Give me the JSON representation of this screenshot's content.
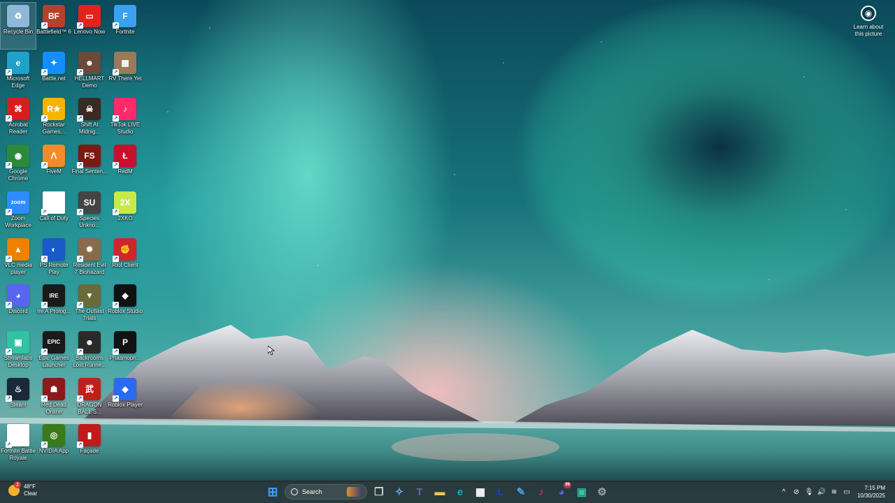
{
  "desktop": {
    "icons": [
      {
        "label": "Recycle Bin",
        "glyph": "♻",
        "color": "#8fb7d8",
        "shortcut": false
      },
      {
        "label": "Battlefield™ 6",
        "glyph": "BF",
        "color": "#b5412a",
        "shortcut": true
      },
      {
        "label": "Lenovo Now",
        "glyph": "▭",
        "color": "#e2231a",
        "shortcut": true
      },
      {
        "label": "Fortnite",
        "glyph": "F",
        "color": "#3aa0f0",
        "shortcut": true
      },
      {
        "label": "Microsoft Edge",
        "glyph": "e",
        "color": "#1fa2c9",
        "shortcut": true
      },
      {
        "label": "Battle.net",
        "glyph": "✦",
        "color": "#148eff",
        "shortcut": true
      },
      {
        "label": "HELLMART Demo",
        "glyph": "☻",
        "color": "#6b4a3a",
        "shortcut": true
      },
      {
        "label": "RV There Yet",
        "glyph": "▦",
        "color": "#9a7a5a",
        "shortcut": true
      },
      {
        "label": "Acrobat Reader",
        "glyph": "⌘",
        "color": "#d4201c",
        "shortcut": true
      },
      {
        "label": "Rockstar Games...",
        "glyph": "R★",
        "color": "#f5b400",
        "shortcut": true
      },
      {
        "label": "Shift At Midnig...",
        "glyph": "☠",
        "color": "#3a2a22",
        "shortcut": true
      },
      {
        "label": "TikTok LIVE Studio",
        "glyph": "♪",
        "color": "#ff2a6a",
        "shortcut": true
      },
      {
        "label": "Google Chrome",
        "glyph": "◉",
        "color": "#2a8a3a",
        "shortcut": true
      },
      {
        "label": "FiveM",
        "glyph": "ᐱ",
        "color": "#f38b29",
        "shortcut": true
      },
      {
        "label": "Final Senten...",
        "glyph": "FS",
        "color": "#7a1a12",
        "shortcut": true
      },
      {
        "label": "RedM",
        "glyph": "Ł",
        "color": "#c8102e",
        "shortcut": true
      },
      {
        "label": "Zoom Workplace",
        "glyph": "zoom",
        "color": "#2d8cff",
        "shortcut": true
      },
      {
        "label": "Call of Duty",
        "glyph": "",
        "color": "#ffffff",
        "shortcut": true
      },
      {
        "label": "Species Unkno...",
        "glyph": "SU",
        "color": "#444444",
        "shortcut": true
      },
      {
        "label": "2XKO",
        "glyph": "2X",
        "color": "#c9e84a",
        "shortcut": true
      },
      {
        "label": "VLC media player",
        "glyph": "▲",
        "color": "#f08000",
        "shortcut": true
      },
      {
        "label": "PS Remote Play",
        "glyph": "◐",
        "color": "#1a5ac8",
        "shortcut": true
      },
      {
        "label": "Resident Evil 7 Biohazard",
        "glyph": "✹",
        "color": "#8a6a48",
        "shortcut": true
      },
      {
        "label": "Riot Client",
        "glyph": "✊",
        "color": "#d0252a",
        "shortcut": true
      },
      {
        "label": "Discord",
        "glyph": "◕",
        "color": "#5865f2",
        "shortcut": true
      },
      {
        "label": "Ire A Prolog...",
        "glyph": "IRE",
        "color": "#1a1a1a",
        "shortcut": true
      },
      {
        "label": "The Outlast Trials",
        "glyph": "▼",
        "color": "#6a6a3a",
        "shortcut": true
      },
      {
        "label": "Roblox Studio",
        "glyph": "◆",
        "color": "#111111",
        "shortcut": true
      },
      {
        "label": "Streamlabs Desktop",
        "glyph": "▣",
        "color": "#31c3a2",
        "shortcut": true
      },
      {
        "label": "Epic Games Launcher",
        "glyph": "EPIC",
        "color": "#1a1a1a",
        "shortcut": true
      },
      {
        "label": "Backrooms Lost Runne...",
        "glyph": "☻",
        "color": "#2a2a2a",
        "shortcut": true
      },
      {
        "label": "Phasmoph...",
        "glyph": "P",
        "color": "#121212",
        "shortcut": true
      },
      {
        "label": "Steam",
        "glyph": "♨",
        "color": "#1b2838",
        "shortcut": true
      },
      {
        "label": "Red Dead Online",
        "glyph": "☗",
        "color": "#8b1a1a",
        "shortcut": true
      },
      {
        "label": "DRAGON BALL S...",
        "glyph": "武",
        "color": "#c0201a",
        "shortcut": true
      },
      {
        "label": "Roblox Player",
        "glyph": "◆",
        "color": "#2a6aef",
        "shortcut": true
      },
      {
        "label": "Fortnite Battle Royale",
        "glyph": "",
        "color": "#ffffff",
        "shortcut": true
      },
      {
        "label": "NVIDIA App",
        "glyph": "◎",
        "color": "#3a7a1a",
        "shortcut": true
      },
      {
        "label": "Façade",
        "glyph": "▮",
        "color": "#c01a1a",
        "shortcut": true
      }
    ]
  },
  "spotlight": {
    "label": "Learn about this picture",
    "icon": "camera-icon"
  },
  "taskbar": {
    "weather": {
      "temp": "48°F",
      "condition": "Clear",
      "badge": "2"
    },
    "search_placeholder": "Search",
    "apps": [
      {
        "name": "start",
        "glyph": "⊞",
        "color": "#3aa0ff"
      },
      {
        "name": "task-view",
        "glyph": "❐",
        "color": "#d0d0d0"
      },
      {
        "name": "copilot",
        "glyph": "✧",
        "color": "#6ab0ff"
      },
      {
        "name": "teams",
        "glyph": "T",
        "color": "#6264a7"
      },
      {
        "name": "file-explorer",
        "glyph": "▬",
        "color": "#f2c94c"
      },
      {
        "name": "edge",
        "glyph": "e",
        "color": "#1fa2c9"
      },
      {
        "name": "store",
        "glyph": "▦",
        "color": "#ffffff"
      },
      {
        "name": "lenovo-l",
        "glyph": "L",
        "color": "#1a3fcc"
      },
      {
        "name": "pen-app",
        "glyph": "✎",
        "color": "#4aa0e0"
      },
      {
        "name": "music",
        "glyph": "♪",
        "color": "#fa2d55"
      },
      {
        "name": "discord",
        "glyph": "◕",
        "color": "#5865f2"
      },
      {
        "name": "streamlabs",
        "glyph": "▣",
        "color": "#31c3a2"
      },
      {
        "name": "settings",
        "glyph": "⚙",
        "color": "#9aa4ae"
      }
    ],
    "discord_badge": "99",
    "tray": {
      "chevron": "^",
      "time": "7:15 PM",
      "date": "10/30/2025"
    }
  }
}
